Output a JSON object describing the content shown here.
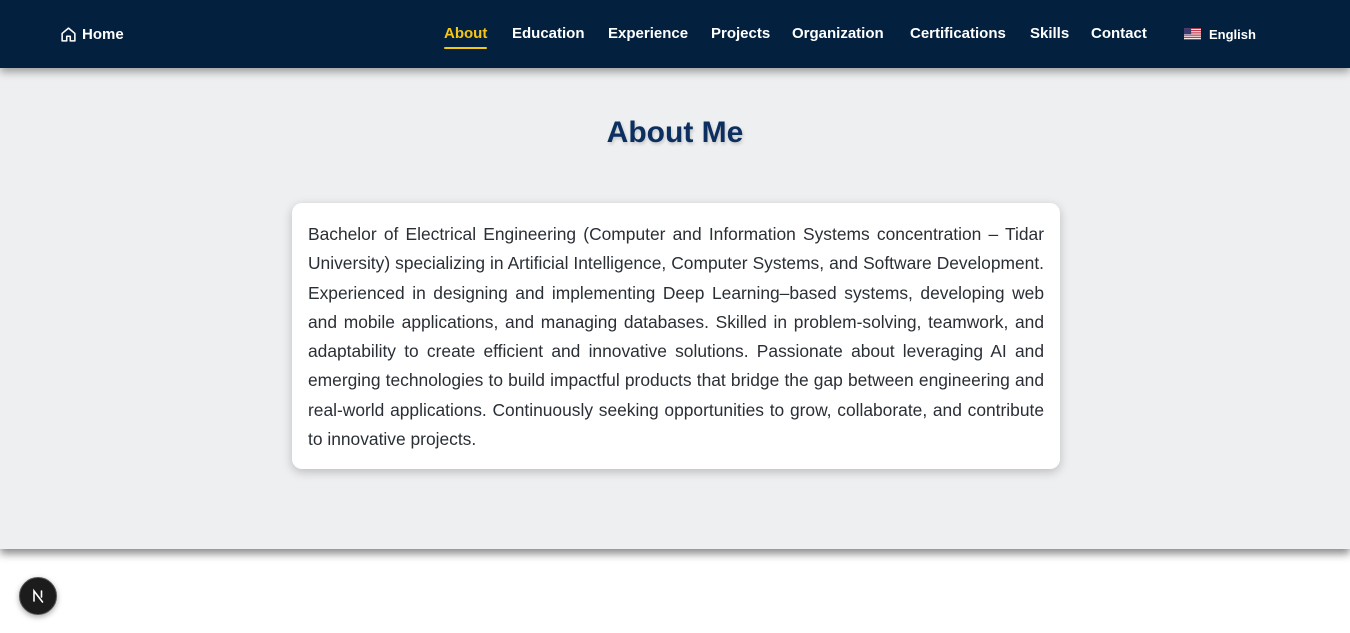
{
  "nav": {
    "home_label": "Home",
    "home_icon": "home-icon",
    "items": [
      {
        "label": "About",
        "active": true
      },
      {
        "label": "Education",
        "active": false
      },
      {
        "label": "Experience",
        "active": false
      },
      {
        "label": "Projects",
        "active": false
      },
      {
        "label": "Organization",
        "active": false
      },
      {
        "label": "Certifications",
        "active": false
      },
      {
        "label": "Skills",
        "active": false
      },
      {
        "label": "Contact",
        "active": false
      }
    ],
    "language": {
      "label": "English",
      "icon": "us-flag-icon"
    }
  },
  "about": {
    "title": "About Me",
    "text": "Bachelor of Electrical Engineering (Computer and Information Systems concentration – Tidar University) specializing in Artificial Intelligence, Computer Systems, and Software Development. Experienced in designing and implementing Deep Learning–based systems, developing web and mobile applications, and managing databases. Skilled in problem-solving, teamwork, and adaptability to create efficient and innovative solutions. Passionate about leveraging AI and emerging technologies to build impactful products that bridge the gap between engineering and real-world applications. Continuously seeking opportunities to grow, collaborate, and contribute to innovative projects."
  },
  "dev_badge": {
    "label": "N",
    "icon": "nextjs-icon"
  },
  "colors": {
    "navbar_bg": "#03203f",
    "accent": "#f5c518",
    "section_bg": "#eeeff1",
    "title": "#0c2f5f"
  }
}
